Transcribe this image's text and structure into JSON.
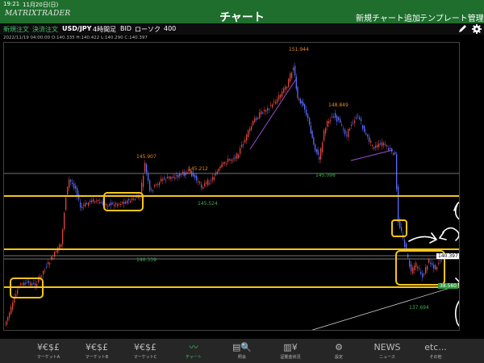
{
  "status": {
    "time": "19:21",
    "date": "11月20日(日)"
  },
  "header": {
    "logo": "MATRIXTRADER",
    "title": "チャート",
    "add_chart": "新規チャート追加",
    "template": "テンプレート管理"
  },
  "toolbar": {
    "new_order": "新規注文",
    "settle_order": "決済注文",
    "pair": "USD/JPY",
    "interval": "4時間足",
    "side": "BID",
    "chart_type": "ローソク",
    "count": "400"
  },
  "info": {
    "datetime": "2022/11/19 04:00:00",
    "open": "O:140.335",
    "high": "H:140.422",
    "low": "L:140.290",
    "close": "C:140.397"
  },
  "chart": {
    "current_price": "140.397",
    "right_price": "38.560",
    "labels": {
      "high1": "151.944",
      "peak2": "148.849",
      "peak3": "145.907",
      "peak4": "145.212",
      "low1": "145.524",
      "low2": "145.098",
      "low3": "140.339",
      "low4": "137.694"
    },
    "colors": {
      "bull": "#e0463a",
      "bear": "#5a6cff",
      "highlight": "#f5c518",
      "label_high": "#e8882a",
      "label_low": "#3fae4f"
    }
  },
  "nav": [
    {
      "icon": "¥€$£",
      "label": "マーケットA"
    },
    {
      "icon": "¥€$£",
      "label": "マーケットB"
    },
    {
      "icon": "¥€$£",
      "label": "マーケットC"
    },
    {
      "icon": "〰",
      "label": "チャート"
    },
    {
      "icon": "▤🔍",
      "label": "照会"
    },
    {
      "icon": "▥¥",
      "label": "証拠金状況"
    },
    {
      "icon": "⚙",
      "label": "設定"
    },
    {
      "icon": "NEWS",
      "label": "ニュース"
    },
    {
      "icon": "etc...",
      "label": "その他"
    }
  ]
}
